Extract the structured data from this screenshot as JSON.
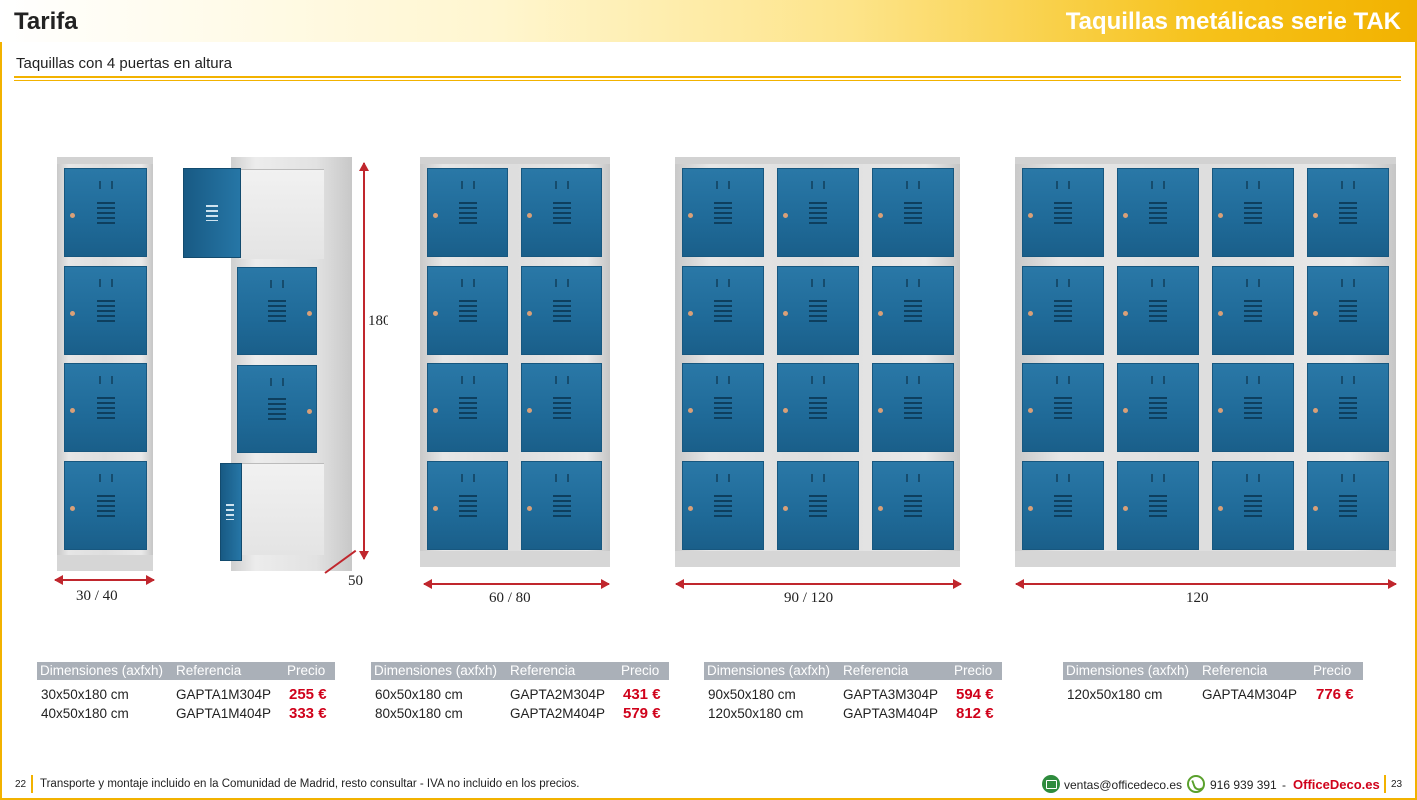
{
  "header": {
    "left_title": "Tarifa",
    "right_title": "Taquillas metálicas serie TAK",
    "subtitle": "Taquillas con 4 puertas en altura"
  },
  "dimensions": {
    "single_width": "30 / 40",
    "single_height": "180",
    "single_depth": "50",
    "double_width": "60 / 80",
    "triple_width": "90 / 120",
    "quad_width": "120"
  },
  "tables": [
    {
      "headers": [
        "Dimensiones (axfxh)",
        "Referencia",
        "Precio"
      ],
      "rows": [
        {
          "dim": "30x50x180 cm",
          "ref": "GAPTA1M304P",
          "price": "255 €"
        },
        {
          "dim": "40x50x180 cm",
          "ref": "GAPTA1M404P",
          "price": "333 €"
        }
      ]
    },
    {
      "headers": [
        "Dimensiones (axfxh)",
        "Referencia",
        "Precio"
      ],
      "rows": [
        {
          "dim": "60x50x180 cm",
          "ref": "GAPTA2M304P",
          "price": "431 €"
        },
        {
          "dim": "80x50x180 cm",
          "ref": "GAPTA2M404P",
          "price": "579 €"
        }
      ]
    },
    {
      "headers": [
        "Dimensiones (axfxh)",
        "Referencia",
        "Precio"
      ],
      "rows": [
        {
          "dim": "90x50x180 cm",
          "ref": "GAPTA3M304P",
          "price": "594 €"
        },
        {
          "dim": "120x50x180 cm",
          "ref": "GAPTA3M404P",
          "price": "812 €"
        }
      ]
    },
    {
      "headers": [
        "Dimensiones (axfxh)",
        "Referencia",
        "Precio"
      ],
      "rows": [
        {
          "dim": "120x50x180 cm",
          "ref": "GAPTA4M304P",
          "price": "776 €"
        }
      ]
    }
  ],
  "footer": {
    "page_left": "22",
    "note": "Transporte y montaje incluido en la Comunidad de Madrid, resto consultar - IVA no incluido en los precios.",
    "email": "ventas@officedeco.es",
    "phone": "916 939 391",
    "separator": "-",
    "brand": "OfficeDeco.es",
    "page_right": "23"
  },
  "colors": {
    "accent": "#f2b200",
    "door_blue": "#1f6a98",
    "price_red": "#d0021b",
    "table_header": "#aab0b8"
  },
  "icons": {
    "email": "email-icon",
    "phone": "phone-icon"
  }
}
